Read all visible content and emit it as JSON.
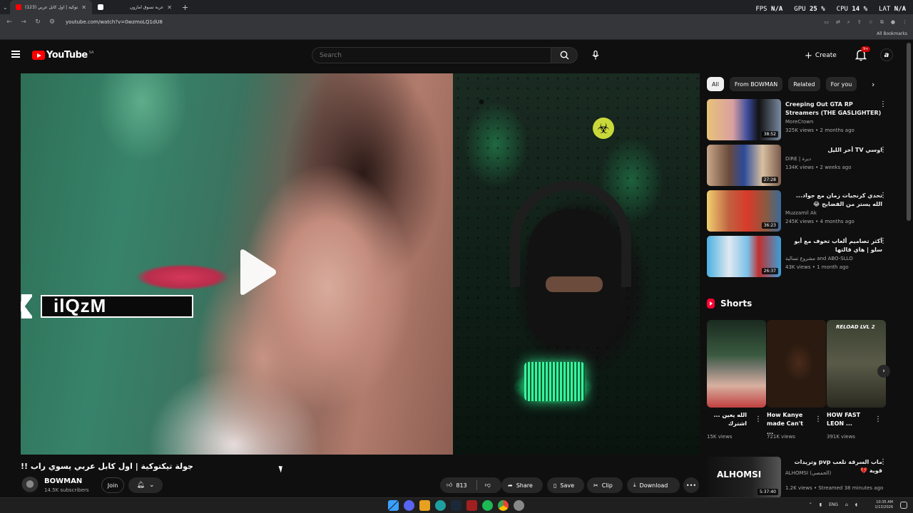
{
  "browser": {
    "tabs": [
      {
        "title": "(123) جولة تيكتوكية | اول كابل عربي",
        "active": true
      },
      {
        "title": "عربة تسوق أمازون",
        "active": false
      }
    ],
    "url": "youtube.com/watch?v=0wzmoLQ1dU8",
    "all_bookmarks": "All Bookmarks"
  },
  "hud": {
    "fps_label": "FPS",
    "fps_value": "N/A",
    "gpu_label": "GPU",
    "gpu_value": "25 %",
    "cpu_label": "CPU",
    "cpu_value": "14 %",
    "lat_label": "LAT",
    "lat_value": "N/A"
  },
  "header": {
    "logo_text": "YouTube",
    "country_code": "SA",
    "search_placeholder": "Search",
    "create_label": "Create",
    "notifications_badge": "9+",
    "avatar_letter": "a"
  },
  "player": {
    "overlay_name": "ilQzM"
  },
  "video": {
    "title": "جولة تيكتوكية | اول كابل عربي يسوي راب !!",
    "channel": "BOWMAN",
    "subscribers": "14.5K subscribers",
    "join_label": "Join",
    "likes": "813",
    "share_label": "Share",
    "save_label": "Save",
    "clip_label": "Clip",
    "download_label": "Download"
  },
  "sidebar": {
    "chips": [
      "All",
      "From BOWMAN",
      "Related",
      "For you"
    ],
    "recommendations": [
      {
        "title": "Creeping Out GTA RP Streamers (THE GASLIGHTER)",
        "channel": "MoreCrown",
        "meta": "325K views • 2 months ago",
        "duration": "38:52"
      },
      {
        "title": "اوسي TV أخر الليل",
        "channel": "DiRE | ديرة",
        "meta": "134K views • 2 weeks ago",
        "duration": "27:28"
      },
      {
        "title": "تحدي كرنجيات زمان مع جواد... الله يستر من الفضايح 😂",
        "channel": "Muzzamil Ak",
        "meta": "245K views • 4 months ago",
        "duration": "36:23"
      },
      {
        "title": "أكثر تصاميم ألعاب تخوف مع أبو سلو | هاي قالتها",
        "channel": "مشروع تسالية and ABO-SLLO",
        "meta": "43K views • 1 month ago",
        "duration": "26:37"
      },
      {
        "title": "ماب السرقة تلعب pvp وتريدات قوية 💔",
        "channel": "ALHOMSI (الحمصي)",
        "meta": "1.2K views • Streamed 38 minutes ago",
        "duration": "5:37:40",
        "thumb_text": "ALHOMSI"
      }
    ],
    "shorts_label": "Shorts",
    "shorts": [
      {
        "title": "الله يعين ... اشترك",
        "views": "15K views"
      },
      {
        "title": "How Kanye made Can't ...",
        "views": "721K views"
      },
      {
        "title": "HOW FAST LEON ...",
        "views": "391K views",
        "thumb_text": "RELOAD LVL 2"
      }
    ]
  },
  "taskbar": {
    "lang": "ENG",
    "time": "10:35 AM",
    "date": "1/13/2026"
  }
}
